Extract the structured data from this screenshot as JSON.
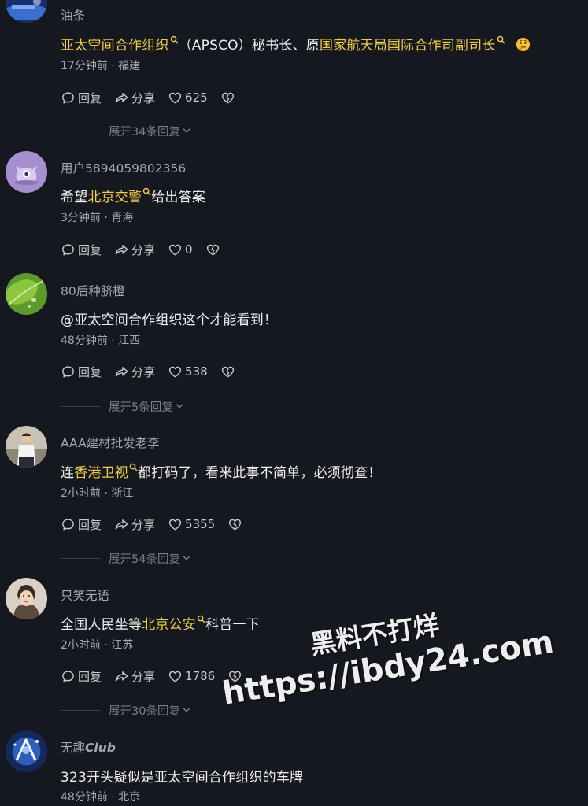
{
  "comments": [
    {
      "username": "油条",
      "text_parts": [
        "亚太空间合作组织",
        "（APSCO）秘书长、原",
        "国家航天局国际合作司副司长"
      ],
      "meta": "17分钟前 · 福建",
      "reply_label": "回复",
      "share_label": "分享",
      "likes": "625",
      "expand": "展开34条回复"
    },
    {
      "username": "用户5894059802356",
      "text_parts": [
        "希望",
        "北京交警",
        "给出答案"
      ],
      "meta": "3分钟前 · 青海",
      "reply_label": "回复",
      "share_label": "分享",
      "likes": "0"
    },
    {
      "username": "80后种脐橙",
      "text": "@亚太空间合作组织这个才能看到！",
      "meta": "48分钟前 · 江西",
      "reply_label": "回复",
      "share_label": "分享",
      "likes": "538",
      "expand": "展开5条回复"
    },
    {
      "username": "AAA建材批发老李",
      "text_parts": [
        "连",
        "香港卫视",
        "都打码了，看来此事不简单，必须彻查！"
      ],
      "meta": "2小时前 · 浙江",
      "reply_label": "回复",
      "share_label": "分享",
      "likes": "5355",
      "expand": "展开54条回复"
    },
    {
      "username": "只笑无语",
      "text_parts": [
        "全国人民坐等",
        "北京公安",
        "科普一下"
      ],
      "meta": "2小时前 · 江苏",
      "reply_label": "回复",
      "share_label": "分享",
      "likes": "1786",
      "expand": "展开30条回复"
    },
    {
      "username_parts": [
        "无趣",
        "Club"
      ],
      "text": "323开头疑似是亚太空间合作组织的车牌",
      "meta": "48分钟前 · 北京"
    }
  ],
  "watermark": {
    "line1": "黑料不打烊",
    "line2": "https://ibdy24.com"
  },
  "colors": {
    "background": "#16181f",
    "highlight": "#f1cd4b",
    "secondary_text": "#a6a8b0"
  },
  "icons": {
    "reply": "speech-bubble-icon",
    "share": "share-arrow-icon",
    "like": "heart-icon",
    "dislike": "broken-heart-icon",
    "search": "search-icon",
    "expand": "chevron-down-icon",
    "emoji": "thinking-face-emoji"
  }
}
